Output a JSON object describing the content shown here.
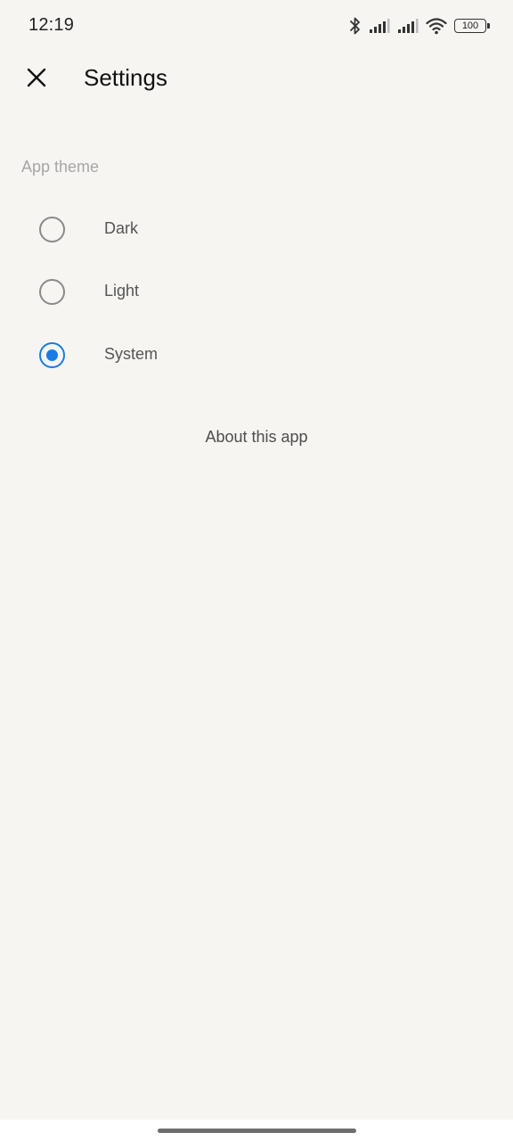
{
  "status_bar": {
    "time": "12:19",
    "battery_level": "100",
    "icons": [
      "bluetooth-icon",
      "cell-signal-icon",
      "cell-signal-icon",
      "wifi-icon",
      "battery-icon"
    ]
  },
  "app_bar": {
    "title": "Settings",
    "close_icon": "close-icon"
  },
  "theme_section": {
    "label": "App theme",
    "options": [
      {
        "label": "Dark",
        "selected": false
      },
      {
        "label": "Light",
        "selected": false
      },
      {
        "label": "System",
        "selected": true
      }
    ]
  },
  "about": {
    "label": "About this app"
  },
  "colors": {
    "background": "#f7f5f2",
    "accent": "#1a7be6",
    "radio_unselected": "#8a8a8a",
    "section_label": "#a6a6a6"
  }
}
